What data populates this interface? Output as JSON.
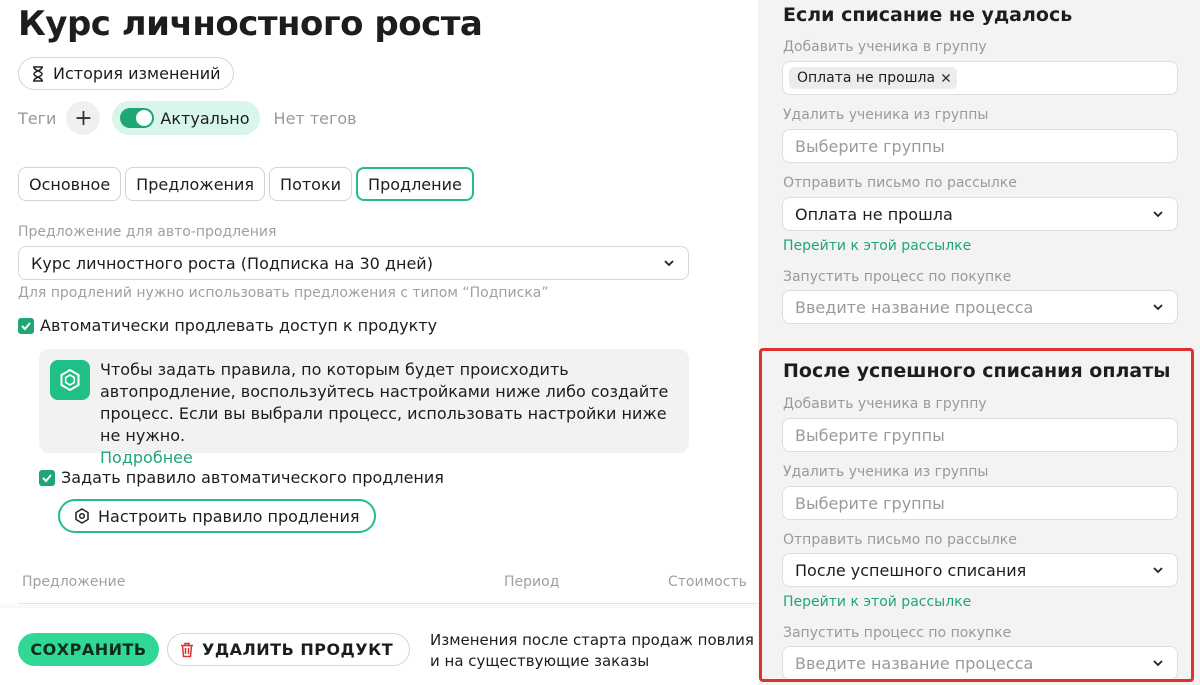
{
  "page": {
    "title": "Курс личностного роста",
    "history_label": "История изменений"
  },
  "tags": {
    "label": "Теги",
    "add": "+",
    "active_label": "Актуально",
    "empty_label": "Нет тегов"
  },
  "tabs": [
    {
      "label": "Основное"
    },
    {
      "label": "Предложения"
    },
    {
      "label": "Потоки"
    },
    {
      "label": "Продление"
    }
  ],
  "renewal": {
    "offer_label": "Предложение для авто-продления",
    "offer_value": "Курс личностного роста (Подписка на 30 дней)",
    "offer_hint": "Для продлений нужно использовать предложения с типом “Подписка”",
    "auto_renew_label": "Автоматически продлевать доступ к продукту",
    "info_text": "Чтобы задать правила, по которым будет происходить автопродление, воспользуйтесь настройками ниже либо создайте процесс. Если вы выбрали процесс, использовать настройки ниже не нужно.",
    "info_link": "Подробнее",
    "rule_check_label": "Задать правило автоматического продления",
    "rule_button_label": "Настроить правило продления"
  },
  "table": {
    "columns": [
      "Предложение",
      "Период",
      "Стоимость"
    ]
  },
  "footer": {
    "save_label": "СОХРАНИТЬ",
    "delete_label": "УДАЛИТЬ ПРОДУКТ",
    "note_line1": "Изменения после старта продаж повлия",
    "note_line2": "и на существующие заказы"
  },
  "fail_section": {
    "title": "Если списание не удалось",
    "add_group_label": "Добавить ученика в группу",
    "add_group_chip": "Оплата не прошла",
    "remove_group_label": "Удалить ученика из группы",
    "remove_group_placeholder": "Выберите группы",
    "mail_label": "Отправить письмо по рассылке",
    "mail_value": "Оплата не прошла",
    "mail_link": "Перейти к этой рассылке",
    "process_label": "Запустить процесс по покупке",
    "process_placeholder": "Введите название процесса"
  },
  "success_section": {
    "title": "После успешного списания оплаты",
    "add_group_label": "Добавить ученика в группу",
    "add_group_placeholder": "Выберите группы",
    "remove_group_label": "Удалить ученика из группы",
    "remove_group_placeholder": "Выберите группы",
    "mail_label": "Отправить письмо по рассылке",
    "mail_value": "После успешного списания",
    "mail_link": "Перейти к этой рассылке",
    "process_label": "Запустить процесс по покупке",
    "process_placeholder": "Введите название процесса"
  },
  "colors": {
    "accent": "#1fbf86",
    "accent_dark": "#1fa675",
    "save_button": "#2fd895",
    "highlight": "#e03131"
  },
  "icons": {
    "history": "hourglass-icon",
    "info": "hexagon-icon",
    "rule": "hexagon-settings-icon",
    "delete": "trash-icon",
    "chevron": "chevron-down-icon",
    "check": "checkmark-icon",
    "remove_chip": "close-icon"
  }
}
